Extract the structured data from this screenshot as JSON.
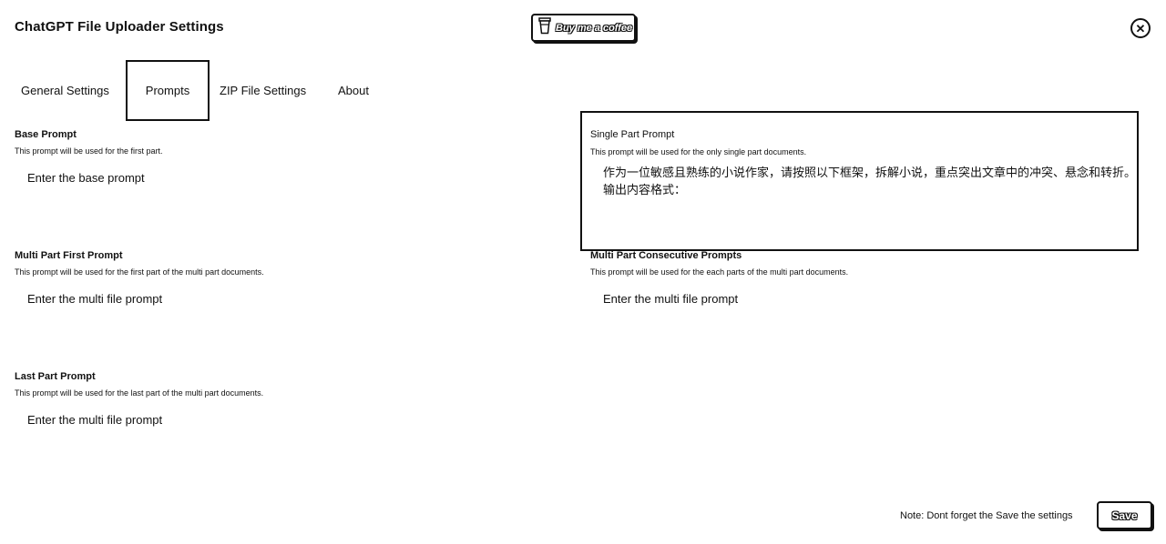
{
  "header": {
    "title": "ChatGPT File Uploader Settings",
    "bmc_label": "Buy me a coffee",
    "close_glyph": "✕"
  },
  "tabs": [
    {
      "label": "General Settings",
      "active": false
    },
    {
      "label": "Prompts",
      "active": true
    },
    {
      "label": "ZIP File Settings",
      "active": false
    },
    {
      "label": "About",
      "active": false
    }
  ],
  "fields": {
    "base": {
      "label": "Base Prompt",
      "description": "This prompt will be used for the first part.",
      "placeholder": "Enter the base prompt"
    },
    "single": {
      "label": "Single Part Prompt",
      "description": "This prompt will be used for the only single part documents.",
      "value": "作为一位敏感且熟练的小说作家，请按照以下框架，拆解小说，重点突出文章中的冲突、悬念和转折。\n输出内容格式："
    },
    "multi_first": {
      "label": "Multi Part First Prompt",
      "description": "This prompt will be used for the first part of the multi part documents.",
      "placeholder": "Enter the multi file prompt"
    },
    "multi_consecutive": {
      "label": "Multi Part Consecutive Prompts",
      "description": "This prompt will be used for the each parts of the multi part documents.",
      "placeholder": "Enter the multi file prompt"
    },
    "last": {
      "label": "Last Part Prompt",
      "description": "This prompt will be used for the last part of the multi part documents.",
      "placeholder": "Enter the multi file prompt"
    }
  },
  "footer": {
    "note": "Note: Dont forget the Save the settings",
    "save_label": "Save"
  },
  "icons": {
    "coffee": "coffee-cup-icon",
    "close": "close-icon"
  }
}
